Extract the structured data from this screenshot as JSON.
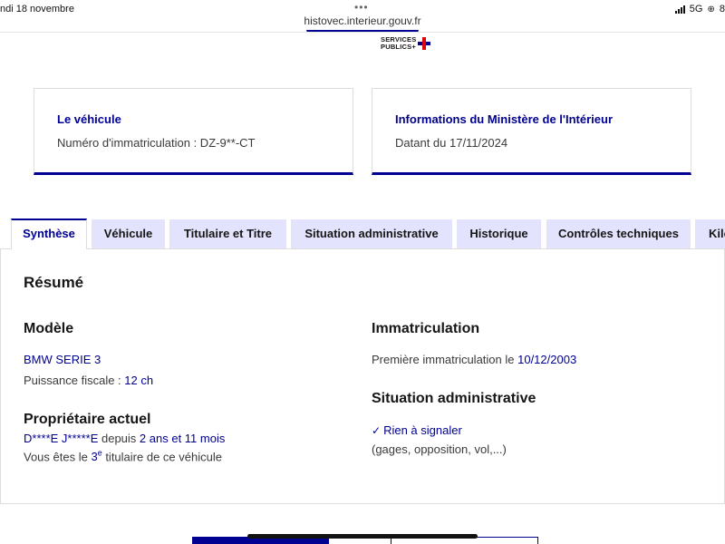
{
  "status": {
    "time": "ndi 18 novembre",
    "network": "5G",
    "battery": "8"
  },
  "browser": {
    "url": "histovec.interieur.gouv.fr"
  },
  "logo": {
    "line1": "SERVICES",
    "line2": "PUBLICS+"
  },
  "cards": {
    "vehicle": {
      "title": "Le véhicule",
      "text": "Numéro d'immatriculation : DZ-9**-CT"
    },
    "ministry": {
      "title": "Informations du Ministère de l'Intérieur",
      "text": "Datant du 17/11/2024"
    }
  },
  "tabs": [
    {
      "label": "Synthèse",
      "active": true
    },
    {
      "label": "Véhicule"
    },
    {
      "label": "Titulaire et Titre"
    },
    {
      "label": "Situation administrative"
    },
    {
      "label": "Historique"
    },
    {
      "label": "Contrôles techniques"
    },
    {
      "label": "Kilométrage"
    }
  ],
  "summary": {
    "title": "Résumé",
    "model": {
      "heading": "Modèle",
      "name": "BMW SERIE 3",
      "power_label": "Puissance fiscale : ",
      "power_value": "12 ch"
    },
    "owner": {
      "heading": "Propriétaire actuel",
      "name": "D****E J*****E",
      "since_label": " depuis ",
      "since_value": "2 ans et 11 mois",
      "rank_prefix": "Vous êtes le ",
      "rank_num": "3",
      "rank_sup": "e",
      "rank_suffix": " titulaire de ce véhicule"
    },
    "registration": {
      "heading": "Immatriculation",
      "label": "Première immatriculation le ",
      "date": "10/12/2003"
    },
    "admin": {
      "heading": "Situation administrative",
      "status": "Rien à signaler",
      "details": "(gages, opposition, vol,...)"
    }
  },
  "colors": {
    "accent": "#000091",
    "tab_bg": "#e3e3fd",
    "logo_red": "#e1000f"
  }
}
